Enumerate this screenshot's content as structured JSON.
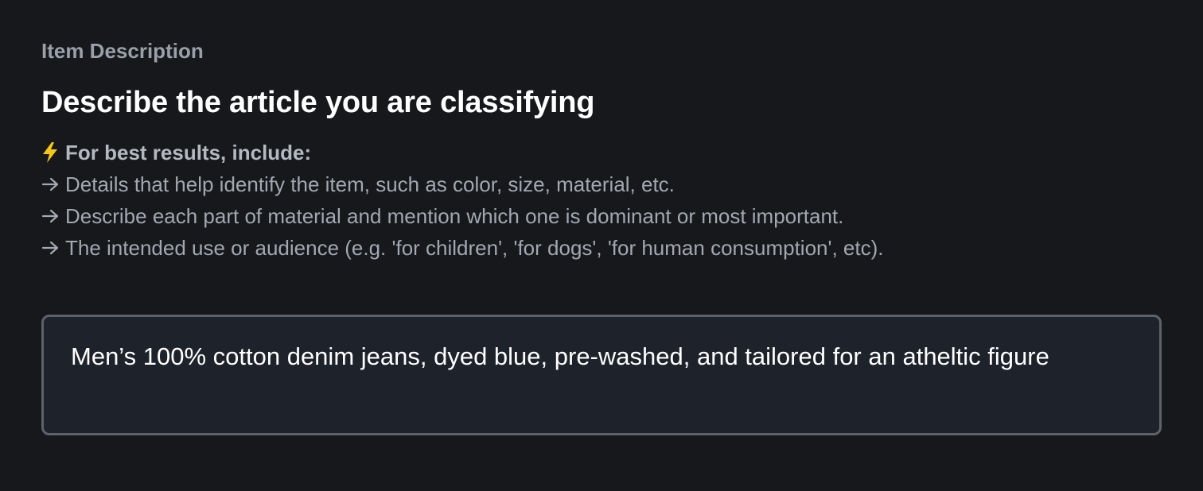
{
  "section": {
    "label": "Item Description",
    "title": "Describe the article you are classifying"
  },
  "hints": {
    "heading_icon": "lightning-bolt-icon",
    "heading": "For best results, include:",
    "bullet_icon": "arrow-right-icon",
    "items": [
      "Details that help identify the item, such as color, size, material, etc.",
      "Describe each part of material and mention which one is dominant or most important.",
      "The intended use or audience (e.g. 'for children', 'for dogs', 'for human consumption', etc)."
    ]
  },
  "description_input": {
    "value": "Men’s 100% cotton denim jeans, dyed blue, pre-washed, and tailored for an atheltic figure"
  },
  "colors": {
    "background": "#16181c",
    "input_background": "#1e222a",
    "input_border": "#5e636b",
    "bolt": "#f5c518"
  }
}
